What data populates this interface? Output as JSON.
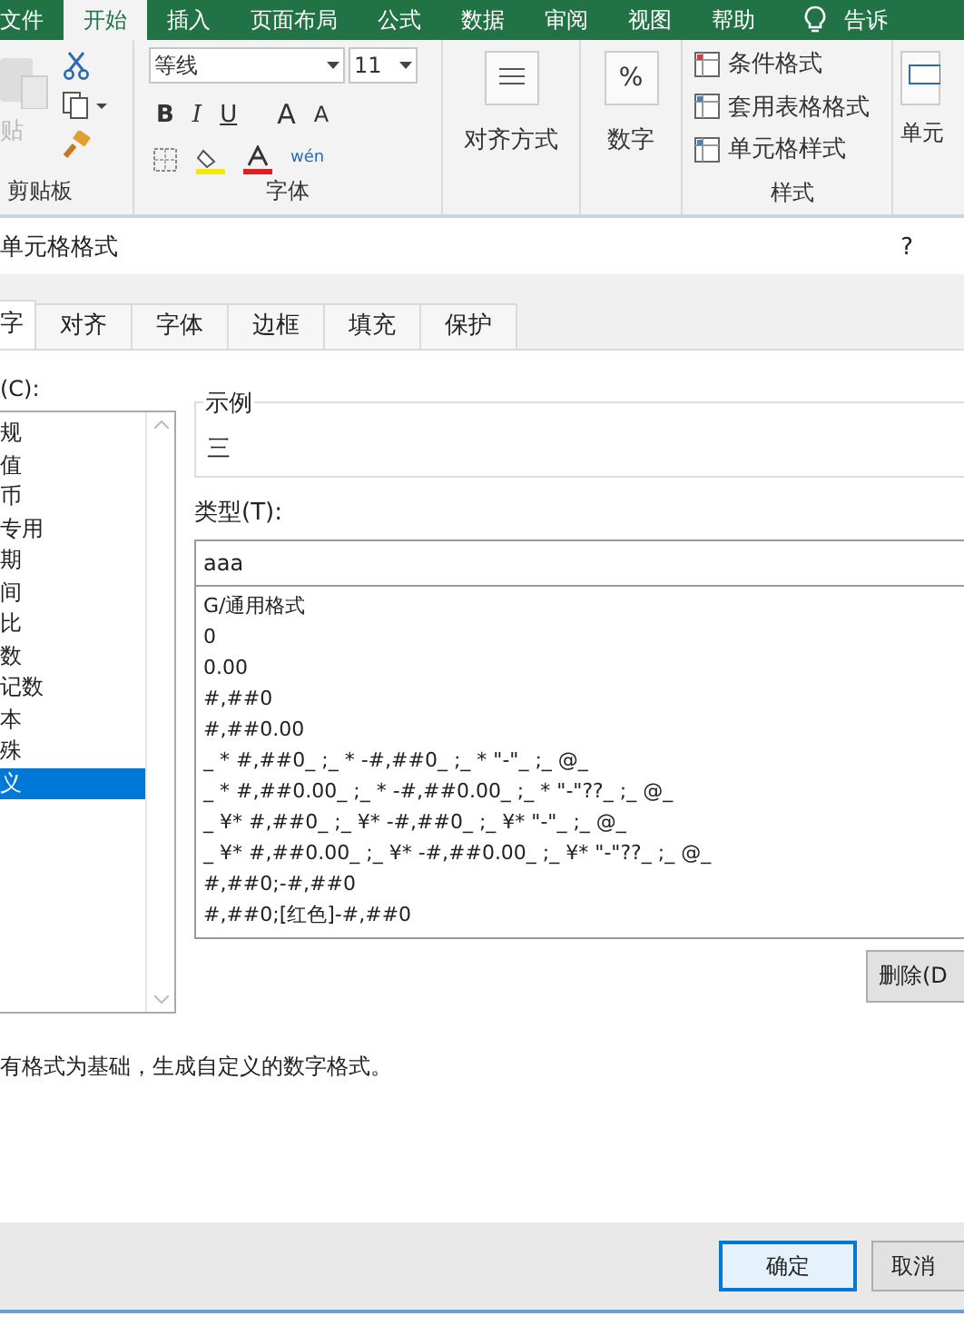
{
  "ribbon_tabs": [
    {
      "label": "文件",
      "selected": false
    },
    {
      "label": "开始",
      "selected": true
    },
    {
      "label": "插入",
      "selected": false
    },
    {
      "label": "页面布局",
      "selected": false
    },
    {
      "label": "公式",
      "selected": false
    },
    {
      "label": "数据",
      "selected": false
    },
    {
      "label": "审阅",
      "selected": false
    },
    {
      "label": "视图",
      "selected": false
    },
    {
      "label": "帮助",
      "selected": false
    }
  ],
  "tell_me": "告诉",
  "clipboard": {
    "paste": "贴",
    "group": "剪贴板"
  },
  "font": {
    "name": "等线",
    "size": "11",
    "group": "字体",
    "bold": "B",
    "italic": "I",
    "underline": "U",
    "grow": "A",
    "shrink": "A",
    "phonetic": "wén"
  },
  "alignment": "对齐方式",
  "number": {
    "symbol": "%",
    "label": "数字"
  },
  "styles": {
    "items": [
      "条件格式",
      "套用表格格式",
      "单元格样式"
    ],
    "group": "样式"
  },
  "cells": "单元",
  "dialog": {
    "title": "单元格格式",
    "help": "?",
    "tabs": [
      {
        "label": "字",
        "selected": true
      },
      {
        "label": "对齐",
        "selected": false
      },
      {
        "label": "字体",
        "selected": false
      },
      {
        "label": "边框",
        "selected": false
      },
      {
        "label": "填充",
        "selected": false
      },
      {
        "label": "保护",
        "selected": false
      }
    ],
    "category_label": "(C):",
    "categories": [
      {
        "label": "规",
        "selected": false
      },
      {
        "label": "值",
        "selected": false
      },
      {
        "label": "币",
        "selected": false
      },
      {
        "label": "专用",
        "selected": false
      },
      {
        "label": "期",
        "selected": false
      },
      {
        "label": "间",
        "selected": false
      },
      {
        "label": "比",
        "selected": false
      },
      {
        "label": "数",
        "selected": false
      },
      {
        "label": "记数",
        "selected": false
      },
      {
        "label": "本",
        "selected": false
      },
      {
        "label": "殊",
        "selected": false
      },
      {
        "label": "义",
        "selected": true
      }
    ],
    "sample_label": "示例",
    "sample_value": "三",
    "type_label": "类型(T):",
    "type_value": "aaa",
    "formats": [
      "G/通用格式",
      "0",
      "0.00",
      "#,##0",
      "#,##0.00",
      "_ * #,##0_ ;_ * -#,##0_ ;_ * \"-\"_ ;_ @_",
      "_ * #,##0.00_ ;_ * -#,##0.00_ ;_ * \"-\"??_ ;_ @_",
      "_ ¥* #,##0_ ;_ ¥* -#,##0_ ;_ ¥* \"-\"_ ;_ @_",
      "_ ¥* #,##0.00_ ;_ ¥* -#,##0.00_ ;_ ¥* \"-\"??_ ;_ @_",
      "#,##0;-#,##0",
      "#,##0;[红色]-#,##0"
    ],
    "delete_button": "删除(D",
    "description": "有格式为基础，生成自定义的数字格式。",
    "ok": "确定",
    "cancel": "取消"
  }
}
